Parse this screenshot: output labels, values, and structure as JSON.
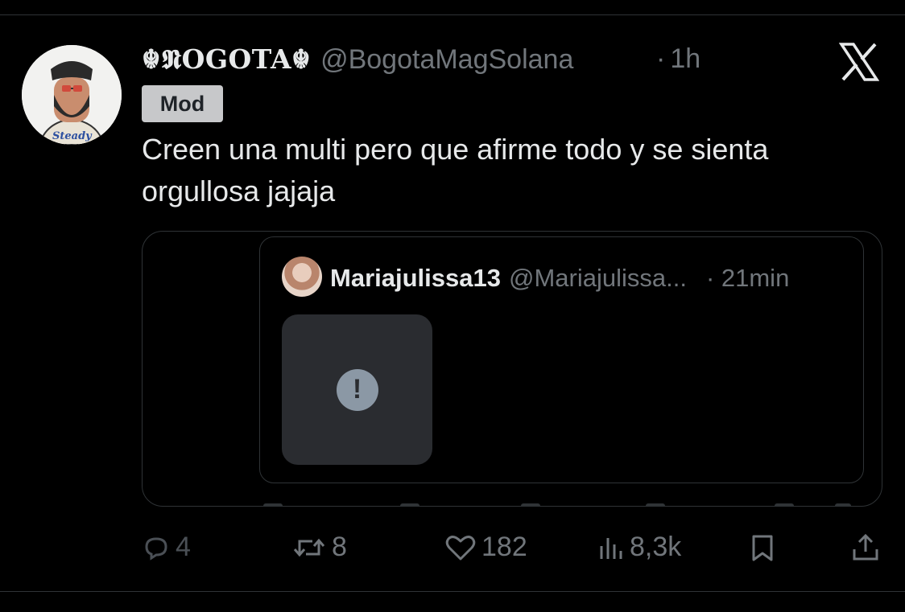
{
  "tweet": {
    "display_name": "☬𝕹OGOTA☬",
    "handle": "@BogotaMagSolana",
    "separator": "·",
    "time": "1h",
    "badge": "Mod",
    "text": "Creen una multi pero que afirme todo y se sienta orgullosa jajaja",
    "avatar_text": "Steady"
  },
  "quoted": {
    "display_name": "Mariajulissa13",
    "handle": "@Mariajulissa...",
    "time": "· 21min",
    "media_status": "!"
  },
  "actions": {
    "replies": "4",
    "reposts": "8",
    "likes": "182",
    "views": "8,3k"
  },
  "icons": {
    "logo": "x-logo-icon",
    "reply": "comment-icon",
    "repost": "repost-icon",
    "like": "heart-icon",
    "views": "views-icon",
    "bookmark": "bookmark-icon",
    "share": "share-icon",
    "media_error": "alert-icon"
  }
}
